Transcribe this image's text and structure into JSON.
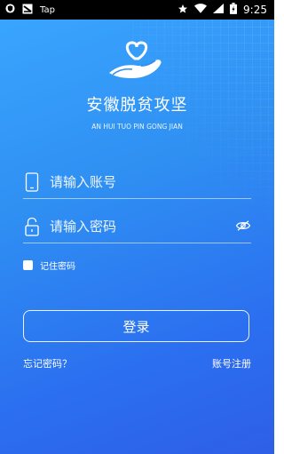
{
  "statusbar": {
    "app_label": "Tap",
    "time": "9:25"
  },
  "app": {
    "title": "安徽脱贫攻坚",
    "subtitle": "AN HUI TUO PIN GONG JIAN"
  },
  "form": {
    "account_placeholder": "请输入账号",
    "password_placeholder": "请输入密码",
    "remember_label": "记住密码",
    "login_label": "登录",
    "forgot_label": "忘记密码？",
    "register_label": "账号注册"
  },
  "icons": {
    "logo": "heart-hand-logo",
    "account": "phone-icon",
    "password": "lock-icon",
    "visibility": "eye-off-icon"
  },
  "colors": {
    "gradient_start": "#3aa7ff",
    "gradient_end": "#2e5fe6"
  }
}
